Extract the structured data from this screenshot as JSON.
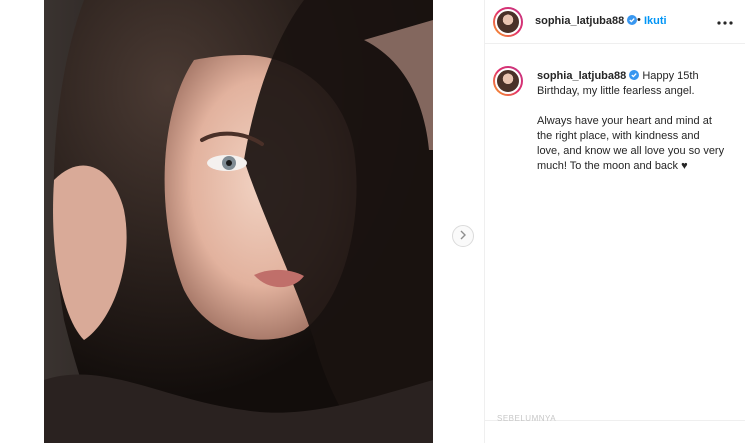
{
  "post": {
    "username": "sophia_latjuba88",
    "follow_label": "Ikuti",
    "separator": "•",
    "caption": {
      "username": "sophia_latjuba88",
      "line1": "Happy 15th",
      "line2": "Birthday, my little fearless angel.",
      "para2": [
        "Always have your heart and mind at",
        "the right place, with kindness and",
        "love, and know we all love you so very",
        "much! To the moon and back ♥"
      ]
    },
    "faint_label": "SEBELUMNYA"
  },
  "colors": {
    "link_blue": "#0095f6",
    "verified_blue": "#3897f0",
    "text": "#262626"
  },
  "icons": {
    "verified": "verified-badge-icon",
    "more": "more-horizontal-icon",
    "next": "chevron-right-icon"
  }
}
